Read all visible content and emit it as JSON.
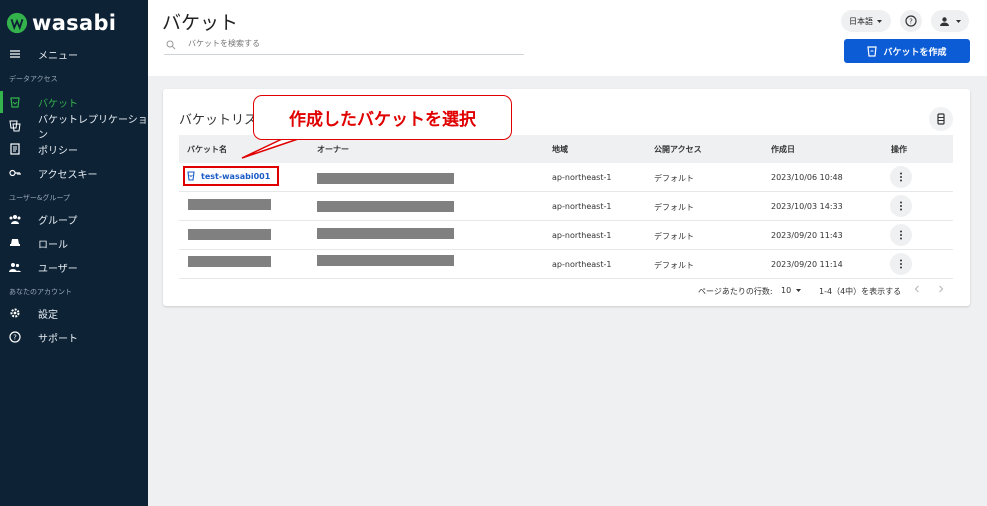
{
  "brand": {
    "name": "wasabi"
  },
  "sidebar": {
    "menu_label": "メニュー",
    "sections": [
      {
        "label": "データアクセス"
      },
      {
        "label": "ユーザー&グループ"
      },
      {
        "label": "あなたのアカウント"
      }
    ],
    "items": [
      {
        "label": "バケット",
        "icon": "bucket-icon",
        "active": true
      },
      {
        "label": "バケットレプリケーション",
        "icon": "replication-icon"
      },
      {
        "label": "ポリシー",
        "icon": "policy-icon"
      },
      {
        "label": "アクセスキー",
        "icon": "key-icon"
      },
      {
        "label": "グループ",
        "icon": "group-icon"
      },
      {
        "label": "ロール",
        "icon": "role-icon"
      },
      {
        "label": "ユーザー",
        "icon": "users-icon"
      },
      {
        "label": "設定",
        "icon": "gear-icon"
      },
      {
        "label": "サポート",
        "icon": "help-icon"
      }
    ]
  },
  "header": {
    "title": "バケット",
    "search_placeholder": "バケットを検索する",
    "language": "日本語",
    "create_button": "バケットを作成"
  },
  "card": {
    "title": "バケットリスト",
    "columns": [
      "バケット名",
      "オーナー",
      "地域",
      "公開アクセス",
      "作成日",
      "操作"
    ],
    "rows": [
      {
        "name": "test-wasabi001",
        "region": "ap-northeast-1",
        "access": "デフォルト",
        "created": "2023/10/06 10:48"
      },
      {
        "name": "",
        "region": "ap-northeast-1",
        "access": "デフォルト",
        "created": "2023/10/03 14:33"
      },
      {
        "name": "",
        "region": "ap-northeast-1",
        "access": "デフォルト",
        "created": "2023/09/20 11:43"
      },
      {
        "name": "",
        "region": "ap-northeast-1",
        "access": "デフォルト",
        "created": "2023/09/20 11:14"
      }
    ],
    "pagination": {
      "rows_per_page_label": "ページあたりの行数:",
      "rows_per_page": "10",
      "range": "1-4（4中）を表示する"
    }
  },
  "annotation": {
    "text": "作成したバケットを選択"
  },
  "colors": {
    "sidebar": "#0d2235",
    "accent": "#34b24b",
    "primary": "#0b5cd5",
    "annotation": "#e00000"
  }
}
